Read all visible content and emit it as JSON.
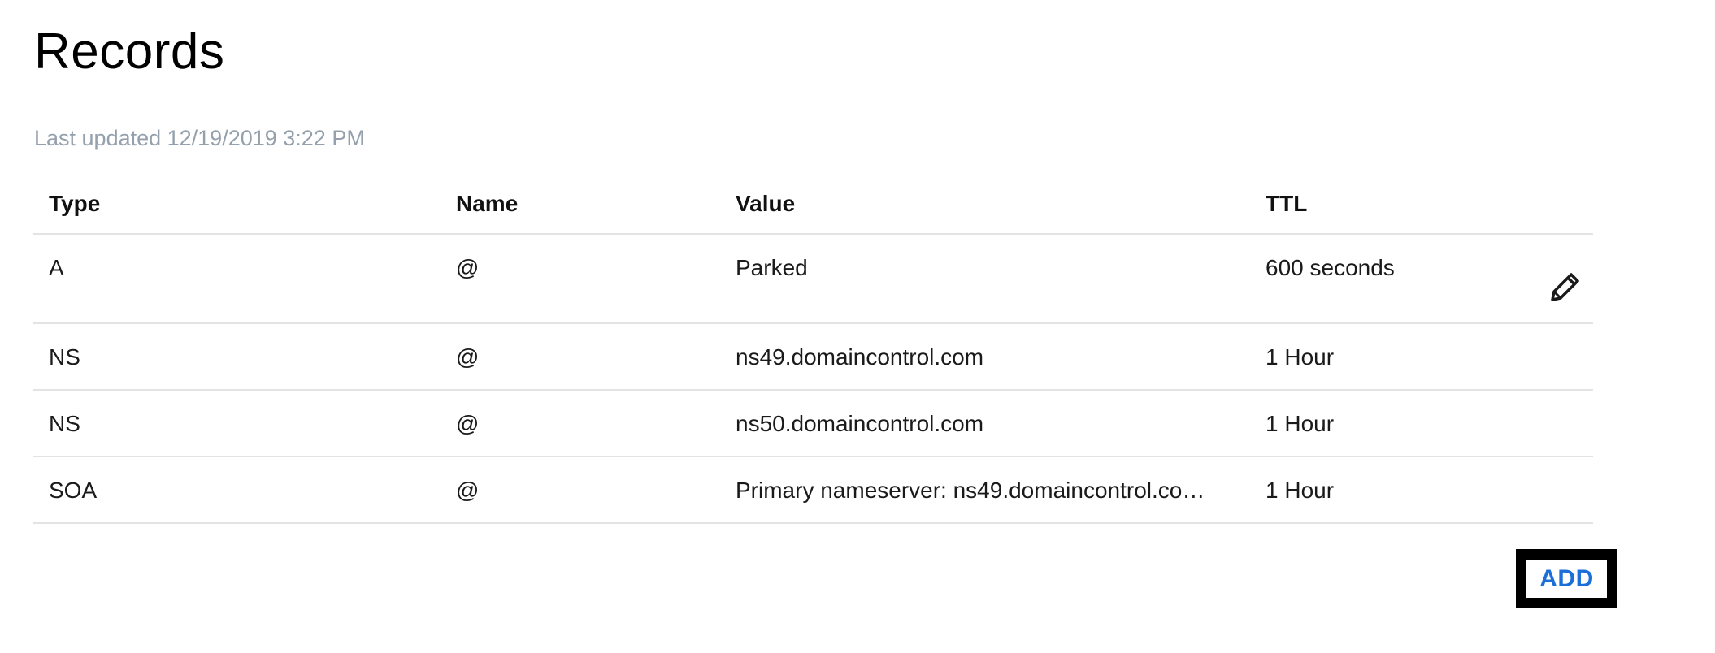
{
  "page": {
    "title": "Records",
    "last_updated": "Last updated 12/19/2019 3:22 PM"
  },
  "table": {
    "headers": {
      "type": "Type",
      "name": "Name",
      "value": "Value",
      "ttl": "TTL"
    },
    "rows": [
      {
        "type": "A",
        "name": "@",
        "value": "Parked",
        "ttl": "600 seconds"
      },
      {
        "type": "NS",
        "name": "@",
        "value": "ns49.domaincontrol.com",
        "ttl": "1 Hour"
      },
      {
        "type": "NS",
        "name": "@",
        "value": "ns50.domaincontrol.com",
        "ttl": "1 Hour"
      },
      {
        "type": "SOA",
        "name": "@",
        "value": "Primary nameserver: ns49.domaincontrol.co…",
        "ttl": "1 Hour"
      }
    ]
  },
  "actions": {
    "add_label": "ADD",
    "edit_icon": "pencil-icon"
  },
  "colors": {
    "accent": "#1b6fd8",
    "muted_text": "#95a0ad",
    "divider": "#e3e3e3"
  }
}
